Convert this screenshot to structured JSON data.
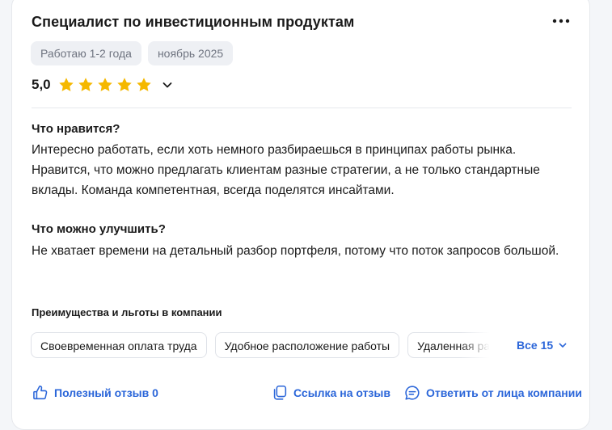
{
  "review": {
    "position": "Специалист по инвестиционным продуктам",
    "tenure": "Работаю 1-2 года",
    "date": "ноябрь 2025",
    "rating": "5,0",
    "rating_value": 5,
    "rating_max": 5,
    "likes_title": "Что нравится?",
    "likes_text": "Интересно работать, если хоть немного разбираешься в принципах работы рынка. Нравится, что можно предлагать клиентам разные стратегии, а не только стандартные вклады. Команда компетентная, всегда поделятся инсайтами.",
    "improve_title": "Что можно улучшить?",
    "improve_text": "Не хватает времени на детальный разбор портфеля, потому что поток запросов большой."
  },
  "benefits": {
    "title": "Преимущества и льготы в компании",
    "items": [
      "Своевременная оплата труда",
      "Удобное расположение работы",
      "Удаленная работа"
    ],
    "show_all": "Все 15"
  },
  "actions": {
    "helpful": "Полезный отзыв 0",
    "link": "Ссылка на отзыв",
    "reply": "Ответить от лица компании"
  },
  "colors": {
    "accent": "#2b66d9",
    "star": "#f5b800",
    "chip_bg": "#eef0f4"
  },
  "icons": [
    "more-icon",
    "star-icon",
    "chevron-down-icon",
    "thumbs-up-icon",
    "copy-link-icon",
    "chat-icon"
  ]
}
